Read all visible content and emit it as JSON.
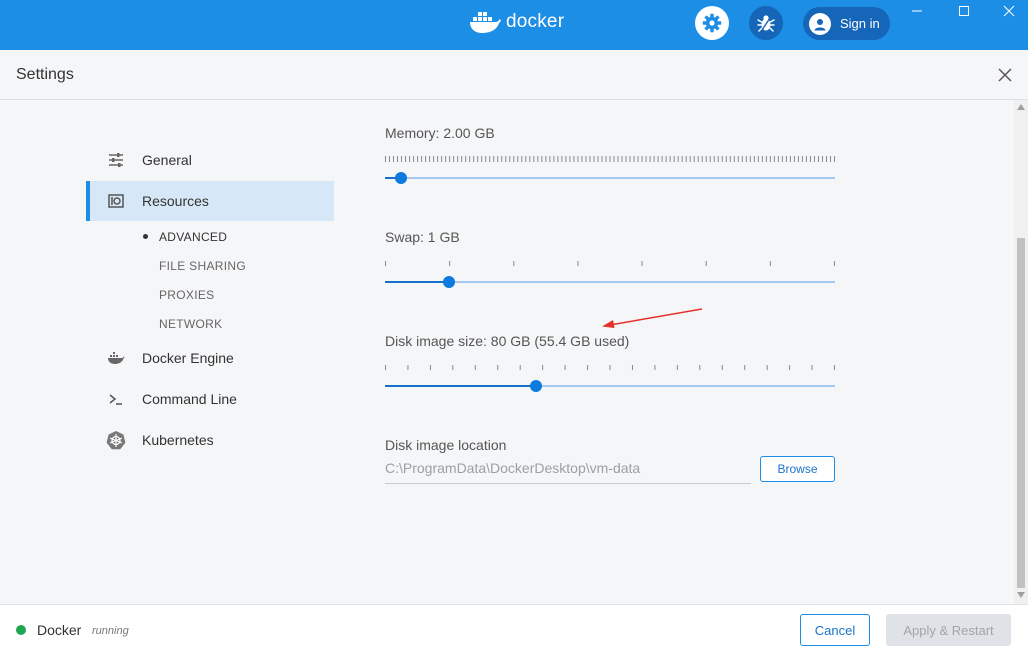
{
  "titlebar": {
    "brand": "docker",
    "signin_label": "Sign in",
    "accent_color": "#1d8ee6"
  },
  "header": {
    "title": "Settings"
  },
  "sidebar": {
    "items": [
      {
        "label": "General",
        "icon": "sliders-icon"
      },
      {
        "label": "Resources",
        "icon": "resources-icon",
        "active": true
      },
      {
        "label": "Docker Engine",
        "icon": "whale-icon"
      },
      {
        "label": "Command Line",
        "icon": "terminal-icon"
      },
      {
        "label": "Kubernetes",
        "icon": "helm-icon"
      }
    ],
    "sub_items": [
      {
        "label": "ADVANCED",
        "active": true
      },
      {
        "label": "FILE SHARING"
      },
      {
        "label": "PROXIES"
      },
      {
        "label": "NETWORK"
      }
    ]
  },
  "resources": {
    "memory": {
      "label": "Memory: 2.00 GB",
      "fraction": 0.035
    },
    "swap": {
      "label": "Swap: 1 GB",
      "fraction": 0.143
    },
    "disk": {
      "label": "Disk image size: 80 GB (55.4 GB used)",
      "fraction": 0.335
    },
    "location": {
      "label": "Disk image location",
      "value": "C:\\ProgramData\\DockerDesktop\\vm-data",
      "browse_label": "Browse"
    }
  },
  "footer": {
    "status_name": "Docker",
    "status_text": "running",
    "status_color": "#20a653",
    "cancel_label": "Cancel",
    "apply_label": "Apply & Restart"
  }
}
